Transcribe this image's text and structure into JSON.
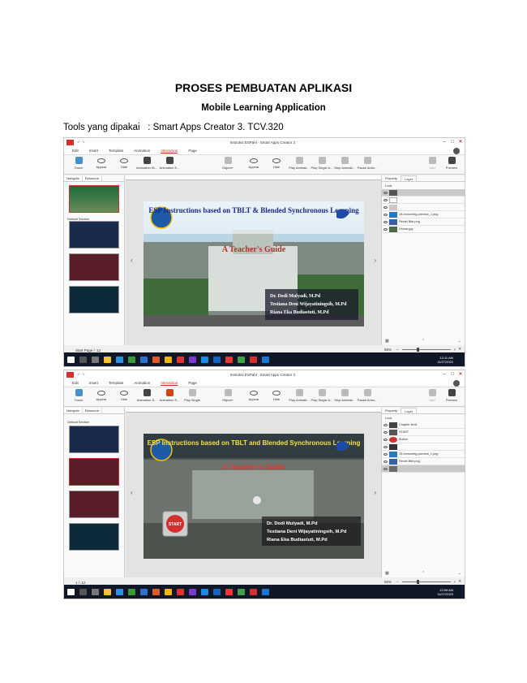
{
  "document": {
    "title": "PROSES PEMBUATAN APLIKASI",
    "subtitle": "Mobile Learning Application",
    "tools_line": "Tools yang dipakai   : Smart Apps Creator 3. TCV.320"
  },
  "app": {
    "window_title": "Instruksi ESPahl - Smart Apps Creator 3",
    "menu": [
      "Edit",
      "Insert",
      "Template",
      "Animation",
      "Interaction",
      "Page"
    ],
    "active_menu": "Interaction",
    "left_tabs": [
      "Navigate",
      "Resource"
    ],
    "section_label": "Default Section",
    "right_tabs": [
      "Property",
      "Layer"
    ],
    "lock_label": "Lock",
    "taskbar_time": "12:11 AM",
    "taskbar_date": "11/27/2020",
    "taskbar_time_2": "12:58 AM"
  },
  "screenshots": [
    {
      "ribbon": [
        "Touch",
        "Appear",
        "Hide",
        "Animation St...",
        "Animation E...",
        "Object+",
        "Appear",
        "Hide",
        "Play Animati...",
        "Play Single A...",
        "Stop Animati...",
        "Pause Anim...",
        "Add",
        "Preview"
      ],
      "layers": [
        "",
        "",
        "",
        "19-removebg-preview_1.png",
        "Rectel Bite.png",
        "Unmar.jpg"
      ],
      "page_indicator": "Start Page  /  :12",
      "zoom": "55%",
      "slide": {
        "title": "ESP Instructions based on TBLT & Blended Synchronous Learning",
        "subtitle": "A Teacher's Guide",
        "authors": [
          "Dr. Dodi Mulyadi, M.Pd",
          "Testiana Deni Wijayatiningsih, M.Pd",
          "Riana Eka Budiastuti, M.Pd"
        ]
      }
    },
    {
      "ribbon": [
        "Touch",
        "Appear",
        "Hide",
        "Animation S...",
        "Animation E...",
        "Play Single",
        "Object+",
        "Appear",
        "Hide",
        "Play Animati...",
        "Play Single A...",
        "Stop Animati...",
        "Pause Anim...",
        "Add",
        "Preview"
      ],
      "layers": [
        "Chapter text1",
        "START",
        "Button",
        "",
        "19-removebg-preview_1.png",
        "Rectel Bite.png",
        ""
      ],
      "page_indicator": "1  /  :12",
      "zoom": "55%",
      "slide": {
        "title": "ESP Instructions based on TBLT and Blended Synchronous Learning",
        "subtitle": "A Teacher's Guide",
        "authors": [
          "Dr. Dodi Mulyadi, M.Pd",
          "Testiana Deni Wijayatiningsih, M.Pd",
          "Riana Eka Budiastuti, M.Pd"
        ],
        "start_button": "START"
      }
    }
  ]
}
